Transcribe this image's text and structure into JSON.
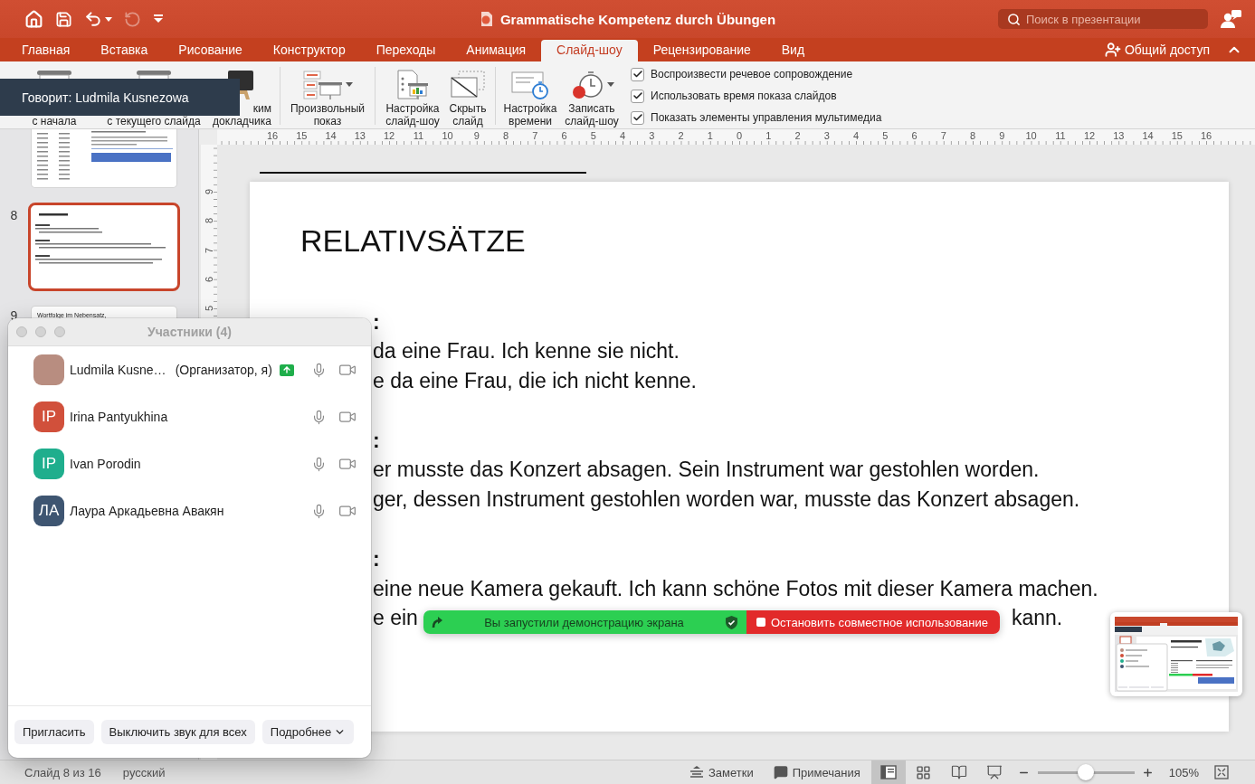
{
  "title_bar": {
    "quick_access": [
      {
        "kind": "home",
        "disabled": false
      },
      {
        "kind": "save",
        "disabled": false
      },
      {
        "kind": "undo",
        "disabled": false
      },
      {
        "kind": "redo",
        "disabled": true
      },
      {
        "kind": "customize",
        "disabled": false
      }
    ],
    "title": "Grammatische Kompetenz durch Übungen",
    "search": {
      "placeholder": "Поиск в презентации"
    }
  },
  "tabs": [
    {
      "label": "Главная",
      "selected": false
    },
    {
      "label": "Вставка",
      "selected": false
    },
    {
      "label": "Рисование",
      "selected": false
    },
    {
      "label": "Конструктор",
      "selected": false
    },
    {
      "label": "Переходы",
      "selected": false
    },
    {
      "label": "Анимация",
      "selected": false
    },
    {
      "label": "Слайд-шоу",
      "selected": true
    },
    {
      "label": "Рецензирование",
      "selected": false
    },
    {
      "label": "Вид",
      "selected": false
    }
  ],
  "share_button": "Общий доступ",
  "ribbon": {
    "groups": [
      {
        "buttons": [
          {
            "kind": "from-start",
            "lines": [
              "с начала"
            ],
            "dropdown": false
          },
          {
            "kind": "from-current",
            "lines": [
              "с текущего слайда"
            ],
            "dropdown": false
          },
          {
            "kind": "presenter",
            "lines": [
              "ким",
              "докладчика"
            ],
            "dropdown": false
          }
        ]
      },
      {
        "buttons": [
          {
            "kind": "custom-show",
            "lines": [
              "Произвольный",
              "показ"
            ],
            "dropdown": true
          }
        ]
      },
      {
        "buttons": [
          {
            "kind": "setup",
            "lines": [
              "Настройка",
              "слайд-шоу"
            ],
            "dropdown": false
          },
          {
            "kind": "hide-slide",
            "lines": [
              "Скрыть",
              "слайд"
            ],
            "dropdown": false
          }
        ]
      },
      {
        "buttons": [
          {
            "kind": "rehearse",
            "lines": [
              "Настройка",
              "времени"
            ],
            "dropdown": false
          },
          {
            "kind": "record",
            "lines": [
              "Записать",
              "слайд-шоу"
            ],
            "dropdown": true
          }
        ]
      }
    ],
    "checkboxes": [
      {
        "label": "Воспроизвести речевое сопровождение",
        "checked": true
      },
      {
        "label": "Использовать время показа слайдов",
        "checked": true
      },
      {
        "label": "Показать элементы управления мультимедиа",
        "checked": true
      }
    ]
  },
  "speaker_tooltip": "Говорит: Ludmila Kusnezowa",
  "rulers": {
    "horizontal": [
      "16",
      "15",
      "14",
      "13",
      "12",
      "11",
      "10",
      "9",
      "8",
      "7",
      "6",
      "5",
      "4",
      "3",
      "2",
      "1",
      "0",
      "1",
      "2",
      "3",
      "4",
      "5",
      "6",
      "7",
      "8",
      "9",
      "10",
      "11",
      "12",
      "13",
      "14",
      "15",
      "16"
    ],
    "vertical": [
      "9",
      "8",
      "7",
      "6",
      "5"
    ]
  },
  "slides_panel": [
    {
      "kind": "worksheet",
      "selected": false
    },
    {
      "kind": "text",
      "number": "8",
      "selected": true
    },
    {
      "kind": "title",
      "number": "9",
      "title": "Wortfolge im Nebensatz,",
      "selected": false
    }
  ],
  "slide": {
    "title": "RELATIVSÄTZE",
    "lines": [
      {
        "kind": "heading",
        "parts": [
          ":"
        ]
      },
      {
        "kind": "text",
        "parts": [
          "da eine Frau. Ich kenne sie nicht."
        ]
      },
      {
        "kind": "text",
        "parts": [
          "e da eine Frau, die ich nicht kenne."
        ]
      },
      {
        "kind": "heading",
        "parts": [
          ":"
        ]
      },
      {
        "kind": "text",
        "parts": [
          "er musste das Konzert absagen. Sein Instrument war gestohlen worden."
        ]
      },
      {
        "kind": "text",
        "parts": [
          "ger, dessen Instrument gestohlen worden war, musste das Konzert absagen."
        ]
      },
      {
        "kind": "heading",
        "parts": [
          ":"
        ]
      },
      {
        "kind": "text",
        "parts": [
          "eine neue Kamera gekauft. Ich kann schöne Fotos mit dieser Kamera machen."
        ]
      },
      {
        "kind": "text",
        "parts": [
          "e ein",
          "kann."
        ]
      }
    ]
  },
  "participants_window": {
    "title": "Участники (4)",
    "participants": [
      {
        "kind": "photo",
        "name": "Ludmila Kusne…",
        "role": "(Организатор, я)",
        "sharing": true
      },
      {
        "kind": "initials",
        "initials": "IP",
        "color": "#d1503b",
        "name": "Irina Pantyukhina",
        "sharing": false
      },
      {
        "kind": "initials",
        "initials": "IP",
        "color": "#1fae8d",
        "name": "Ivan Porodin",
        "sharing": false
      },
      {
        "kind": "initials",
        "initials": "ЛА",
        "color": "#3e5571",
        "name": "Лаура Аркадьевна Авакян",
        "sharing": false
      }
    ],
    "buttons": [
      {
        "label": "Пригласить",
        "dropdown": false
      },
      {
        "label": "Выключить звук для всех",
        "dropdown": false
      },
      {
        "label": "Подробнее",
        "dropdown": true
      }
    ]
  },
  "share_bar": {
    "status": "Вы запустили демонстрацию экрана",
    "stop_button": "Остановить совместное использование"
  },
  "status_bar": {
    "slide_position": "Слайд 8 из 16",
    "language": "русский",
    "notes": "Заметки",
    "comments": "Примечания",
    "views": [
      {
        "kind": "normal",
        "selected": true
      },
      {
        "kind": "sorter",
        "selected": false
      },
      {
        "kind": "reading",
        "selected": false
      },
      {
        "kind": "slideshow",
        "selected": false
      }
    ],
    "zoom": {
      "level": 0.5,
      "reading": "105%"
    }
  }
}
